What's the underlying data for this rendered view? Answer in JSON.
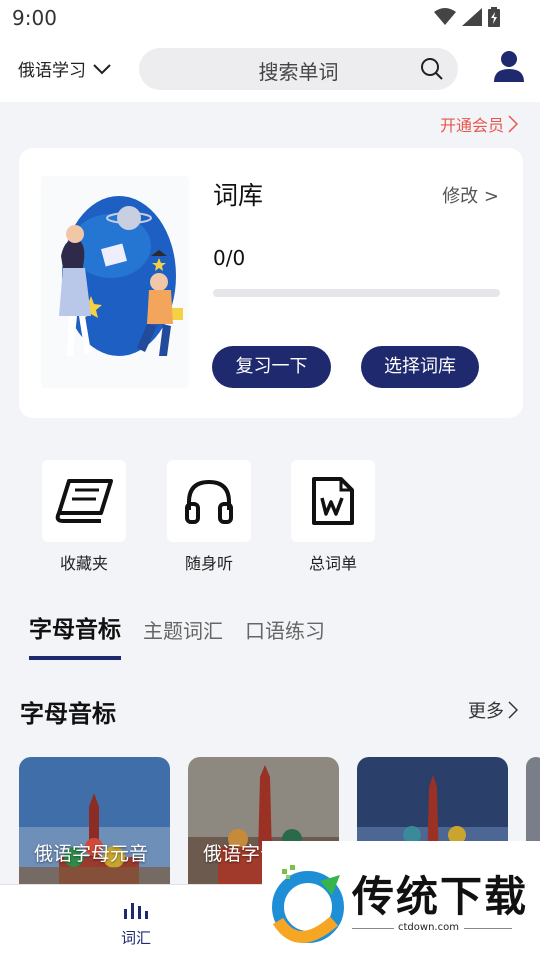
{
  "status_bar": {
    "time": "9:00",
    "icons": [
      "wifi-icon",
      "cell-signal-icon",
      "battery-charging-icon"
    ]
  },
  "header": {
    "language_selector": "俄语学习",
    "search_placeholder": "搜索单词",
    "icons": [
      "chevron-down-icon",
      "search-icon",
      "user-icon"
    ]
  },
  "vip_link": "开通会员",
  "wordbank_card": {
    "title": "词库",
    "edit_label": "修改 >",
    "progress_text": "0/0",
    "progress_fraction": 0,
    "review_button": "复习一下",
    "choose_button": "选择词库"
  },
  "tools": [
    {
      "label": "收藏夹",
      "icon": "book-icon"
    },
    {
      "label": "随身听",
      "icon": "headphones-icon"
    },
    {
      "label": "总词单",
      "icon": "word-document-icon"
    }
  ],
  "tabs": [
    {
      "label": "字母音标",
      "active": true
    },
    {
      "label": "主题词汇",
      "active": false
    },
    {
      "label": "口语练习",
      "active": false
    }
  ],
  "section": {
    "title": "字母音标",
    "more_label": "更多"
  },
  "cards": [
    {
      "label": "俄语字母元音"
    },
    {
      "label": "俄语字母"
    },
    {
      "label": ""
    }
  ],
  "bottom_nav": [
    {
      "label": "词汇",
      "icon": "bar-chart-icon",
      "active": true
    }
  ],
  "watermark": {
    "text": "传统下载",
    "site": "ctdown.com"
  },
  "colors": {
    "accent": "#1f2a6e",
    "vip": "#e8574f",
    "background": "#f3f4f8"
  }
}
